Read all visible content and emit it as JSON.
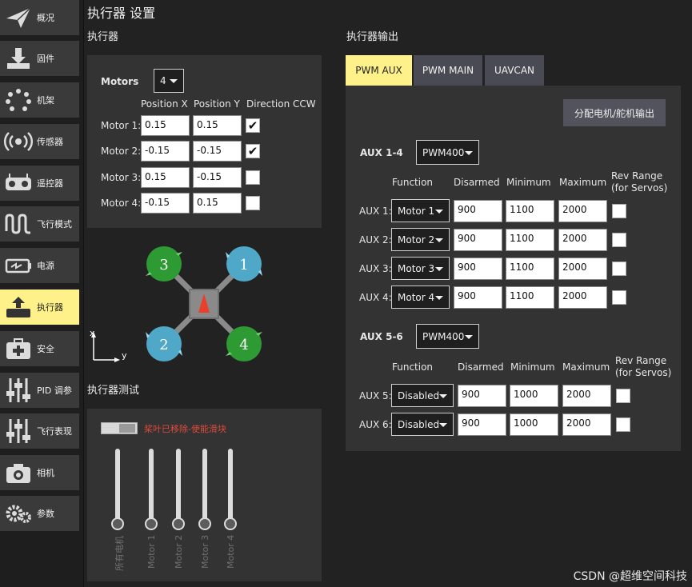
{
  "sidebar": {
    "items": [
      {
        "label": "概况",
        "icon": "paper-plane-icon"
      },
      {
        "label": "固件",
        "icon": "download-icon"
      },
      {
        "label": "机架",
        "icon": "airframe-dots-icon"
      },
      {
        "label": "传感器",
        "icon": "radio-waves-icon"
      },
      {
        "label": "遥控器",
        "icon": "remote-controller-icon"
      },
      {
        "label": "飞行模式",
        "icon": "wave-icon"
      },
      {
        "label": "电源",
        "icon": "battery-icon"
      },
      {
        "label": "执行器",
        "icon": "actuator-icon",
        "active": true
      },
      {
        "label": "安全",
        "icon": "first-aid-icon"
      },
      {
        "label": "PID 调参",
        "icon": "sliders-icon"
      },
      {
        "label": "飞行表现",
        "icon": "sliders-icon"
      },
      {
        "label": "相机",
        "icon": "camera-icon"
      },
      {
        "label": "参数",
        "icon": "gears-icon"
      }
    ]
  },
  "page_title": "执行器 设置",
  "actuators": {
    "title": "执行器",
    "motors_label": "Motors",
    "motors_count": "4",
    "col_pos_x": "Position X",
    "col_pos_y": "Position Y",
    "col_dir": "Direction CCW",
    "rows": [
      {
        "label": "Motor 1:",
        "x": "0.15",
        "y": "0.15",
        "ccw": true
      },
      {
        "label": "Motor 2:",
        "x": "-0.15",
        "y": "-0.15",
        "ccw": true
      },
      {
        "label": "Motor 3:",
        "x": "0.15",
        "y": "-0.15",
        "ccw": false
      },
      {
        "label": "Motor 4:",
        "x": "-0.15",
        "y": "0.15",
        "ccw": false
      }
    ]
  },
  "diagram": {
    "motor_numbers": [
      "1",
      "2",
      "3",
      "4"
    ],
    "axis_x": "x",
    "axis_y": "y",
    "colors": {
      "cw": "#4fa8c8",
      "ccw": "#2e9a33",
      "body": "#8a8a8a",
      "arrow": "#e8402a"
    }
  },
  "test": {
    "title": "执行器测试",
    "warning": "桨叶已移除-使能滑块",
    "sliders": [
      "所有电机",
      "Motor 1",
      "Motor 2",
      "Motor 3",
      "Motor 4"
    ]
  },
  "output": {
    "title": "执行器输出",
    "tabs": [
      "PWM AUX",
      "PWM MAIN",
      "UAVCAN"
    ],
    "assign_button": "分配电机/舵机输出",
    "groups": [
      {
        "label": "AUX 1-4",
        "rate": "PWM400",
        "headers": {
          "function": "Function",
          "disarmed": "Disarmed",
          "minimum": "Minimum",
          "maximum": "Maximum",
          "rev": "Rev Range\n(for Servos)"
        },
        "rows": [
          {
            "label": "AUX 1:",
            "function": "Motor 1",
            "disarmed": "900",
            "min": "1100",
            "max": "2000"
          },
          {
            "label": "AUX 2:",
            "function": "Motor 2",
            "disarmed": "900",
            "min": "1100",
            "max": "2000"
          },
          {
            "label": "AUX 3:",
            "function": "Motor 3",
            "disarmed": "900",
            "min": "1100",
            "max": "2000"
          },
          {
            "label": "AUX 4:",
            "function": "Motor 4",
            "disarmed": "900",
            "min": "1100",
            "max": "2000"
          }
        ]
      },
      {
        "label": "AUX 5-6",
        "rate": "PWM400",
        "headers": {
          "function": "Function",
          "disarmed": "Disarmed",
          "minimum": "Minimum",
          "maximum": "Maximum",
          "rev": "Rev Range\n(for Servos)"
        },
        "rows": [
          {
            "label": "AUX 5:",
            "function": "Disabled",
            "disarmed": "900",
            "min": "1000",
            "max": "2000"
          },
          {
            "label": "AUX 6:",
            "function": "Disabled",
            "disarmed": "900",
            "min": "1000",
            "max": "2000"
          }
        ]
      }
    ]
  },
  "watermark": "CSDN @超维空间科技",
  "colors": {
    "accent": "#fff18a",
    "panel": "#333333",
    "tab": "#4a4a55"
  }
}
